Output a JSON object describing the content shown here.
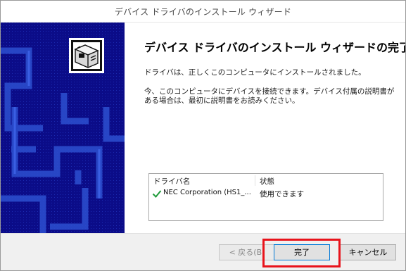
{
  "window": {
    "title": "デバイス ドライバのインストール ウィザード"
  },
  "banner": {
    "icon": "computer-box-icon",
    "background_color": "#0b0c88"
  },
  "content": {
    "heading": "デバイス ドライバのインストール ウィザードの完了",
    "paragraph1": "ドライバは、正しくこのコンピュータにインストールされました。",
    "paragraph2": "今、このコンピュータにデバイスを接続できます。デバイス付属の説明書がある場合は、最初に説明書をお読みください。"
  },
  "driver_table": {
    "headers": [
      "ドライバ名",
      "状態"
    ],
    "rows": [
      {
        "icon": "checkmark-icon",
        "name": "NEC Corporation (HS1_...",
        "status": "使用できます"
      }
    ]
  },
  "buttons": {
    "back": "< 戻る(B)",
    "finish": "完了",
    "cancel": "キャンセル"
  },
  "colors": {
    "highlight": "#e8131b",
    "check": "#1f9b3a",
    "focus": "#0078d7"
  }
}
